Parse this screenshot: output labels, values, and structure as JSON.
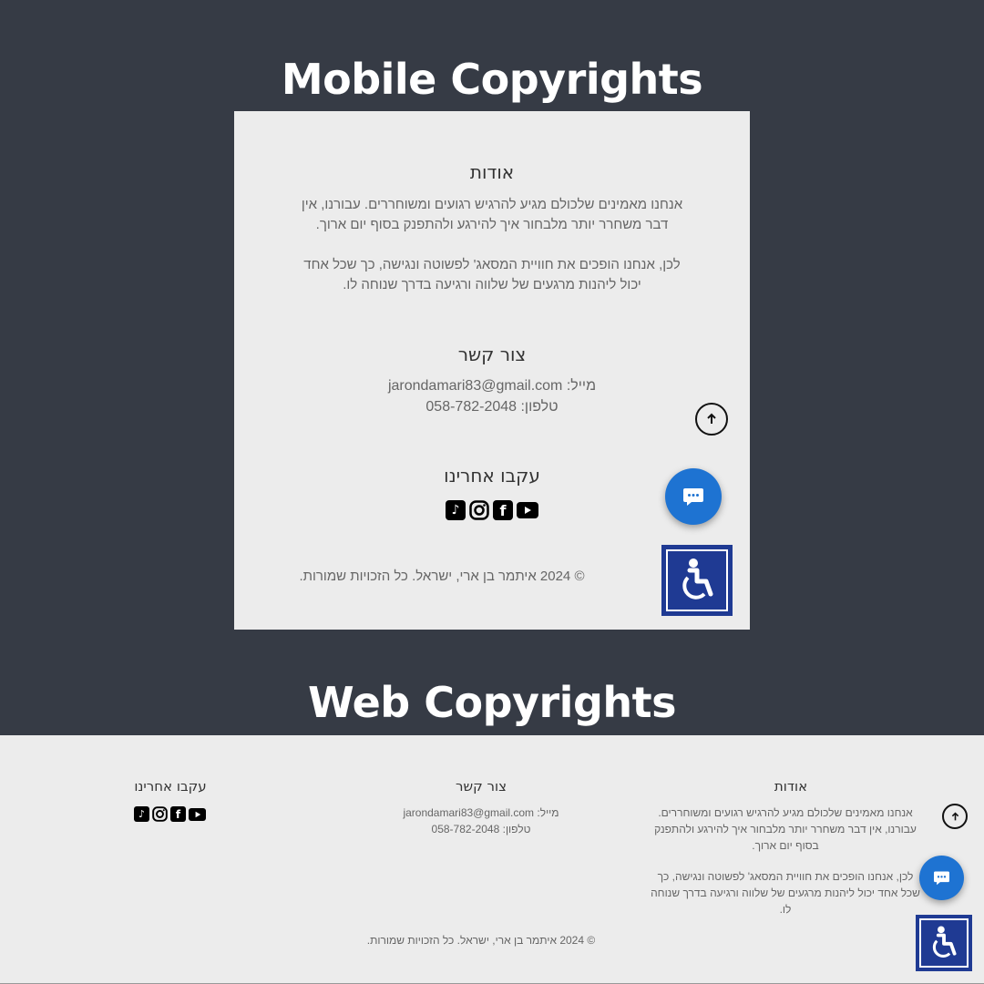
{
  "headings": {
    "mobile": "Mobile Copyrights",
    "web": "Web Copyrights"
  },
  "about": {
    "title": "אודות",
    "paragraph1": "אנחנו מאמינים שלכולם מגיע להרגיש רגועים ומשוחררים. עבורנו, אין דבר משחרר יותר מלבחור איך להירגע ולהתפנק בסוף יום ארוך.",
    "paragraph2": "לכן, אנחנו הופכים את חוויית המסאג' לפשוטה ונגישה, כך שכל אחד יכול ליהנות מרגעים של שלווה ורגיעה בדרך שנוחה לו."
  },
  "contact": {
    "title": "צור קשר",
    "email_label": "מייל:",
    "email": "jarondamari83@gmail.com",
    "phone_label": "טלפון:",
    "phone": "058-782-2048"
  },
  "follow": {
    "title": "עקבו אחרינו",
    "icons": [
      "tiktok-icon",
      "instagram-icon",
      "facebook-icon",
      "youtube-icon"
    ]
  },
  "copyright": "© 2024 איתמר בן ארי, ישראל. כל הזכויות שמורות.",
  "colors": {
    "background": "#363b45",
    "panel": "#ececec",
    "chat_button": "#1e73d2",
    "accessibility_button": "#1f3a93"
  }
}
